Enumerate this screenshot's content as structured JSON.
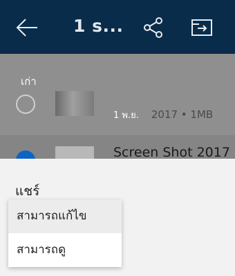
{
  "header": {
    "title": "1 s...",
    "icons": [
      "back-arrow-icon",
      "share-icon",
      "move-to-folder-icon"
    ],
    "background": "#0a2c4b"
  },
  "list": {
    "section_label": "เก่า",
    "row1": {
      "date": "1 พ.ย.",
      "info": "2017 • 1MB"
    },
    "row2": {
      "name": "Screen Shot 2017",
      "selected": true
    }
  },
  "share_sheet": {
    "title": "แชร์",
    "options": [
      {
        "label": "สามารถแก้ไข",
        "selected": true
      },
      {
        "label": "สามารถดู",
        "selected": false
      }
    ]
  },
  "colors": {
    "accent": "#0e63c6",
    "scrim": "#8f8f8f"
  }
}
